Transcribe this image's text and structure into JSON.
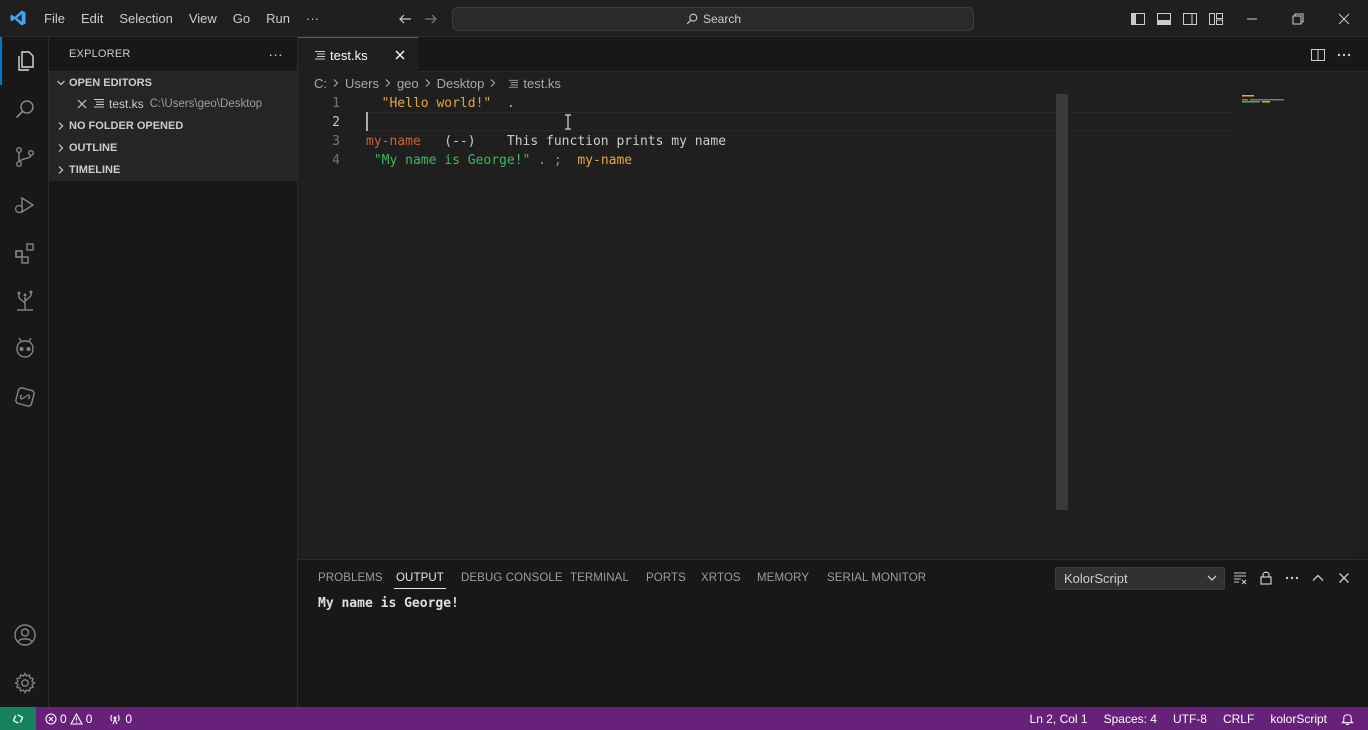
{
  "menu": [
    "File",
    "Edit",
    "Selection",
    "View",
    "Go",
    "Run",
    "···"
  ],
  "search": {
    "label": "Search"
  },
  "sidebar": {
    "title": "EXPLORER",
    "more": "···",
    "sections": {
      "open_editors": "OPEN EDITORS",
      "no_folder": "NO FOLDER OPENED",
      "outline": "OUTLINE",
      "timeline": "TIMELINE"
    },
    "open_editors": [
      {
        "name": "test.ks",
        "path": "C:\\Users\\geo\\Desktop"
      }
    ]
  },
  "tabs": [
    {
      "label": "test.ks",
      "active": true
    }
  ],
  "breadcrumb": [
    "C:",
    "Users",
    "geo",
    "Desktop",
    "test.ks"
  ],
  "editor": {
    "line_numbers": [
      "1",
      "2",
      "3",
      "4"
    ],
    "lines": [
      [
        {
          "text": "  \"Hello world!\"",
          "color": "#e5a73b"
        },
        {
          "text": "  .",
          "color": "#e5a73b"
        }
      ],
      [],
      [
        {
          "text": "my-name",
          "color": "#d1602e"
        },
        {
          "text": "   (--)    This function prints my name",
          "color": "#cccccc"
        }
      ],
      [
        {
          "text": " \"My name is George!\"",
          "color": "#3cb95c"
        },
        {
          "text": " . ;  ",
          "color": "#c5739c"
        },
        {
          "text": "my-name",
          "color": "#e5a73b"
        }
      ]
    ]
  },
  "panel": {
    "tabs": [
      "PROBLEMS",
      "OUTPUT",
      "DEBUG CONSOLE",
      "TERMINAL",
      "PORTS",
      "XRTOS",
      "MEMORY",
      "SERIAL MONITOR"
    ],
    "active_tab": "OUTPUT",
    "channel": "KolorScript",
    "output": "My name is George!"
  },
  "statusbar": {
    "errors": "0",
    "warnings": "0",
    "ports": "0",
    "position": "Ln 2, Col 1",
    "spaces": "Spaces: 4",
    "encoding": "UTF-8",
    "eol": "CRLF",
    "language": "kolorScript"
  },
  "colors": {
    "accent": "#0078d4",
    "statusbar": "#68217a",
    "remote": "#16825d"
  }
}
